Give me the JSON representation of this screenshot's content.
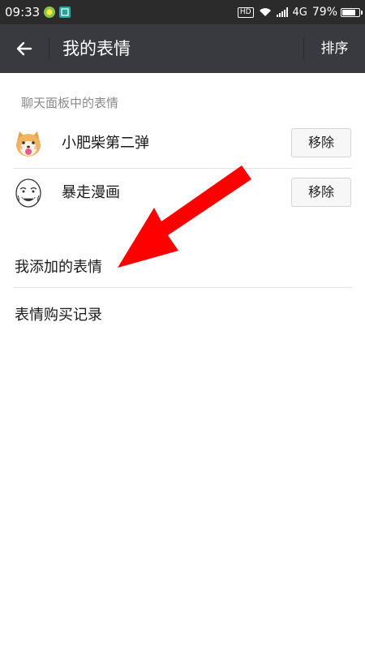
{
  "status_bar": {
    "time": "09:33",
    "hd": "HD",
    "network": "4G",
    "battery_percent": "79%",
    "battery_level": 0.79
  },
  "header": {
    "title": "我的表情",
    "sort_label": "排序"
  },
  "chat_panel": {
    "section_title": "聊天面板中的表情",
    "items": [
      {
        "name": "小肥柴第二弹",
        "remove_label": "移除"
      },
      {
        "name": "暴走漫画",
        "remove_label": "移除"
      }
    ]
  },
  "menu": {
    "added_stickers": "我添加的表情",
    "purchase_history": "表情购买记录"
  },
  "colors": {
    "title_bar": "#393a3f",
    "status_bar": "#2b2b2b",
    "annotation_arrow": "#ff0000"
  }
}
